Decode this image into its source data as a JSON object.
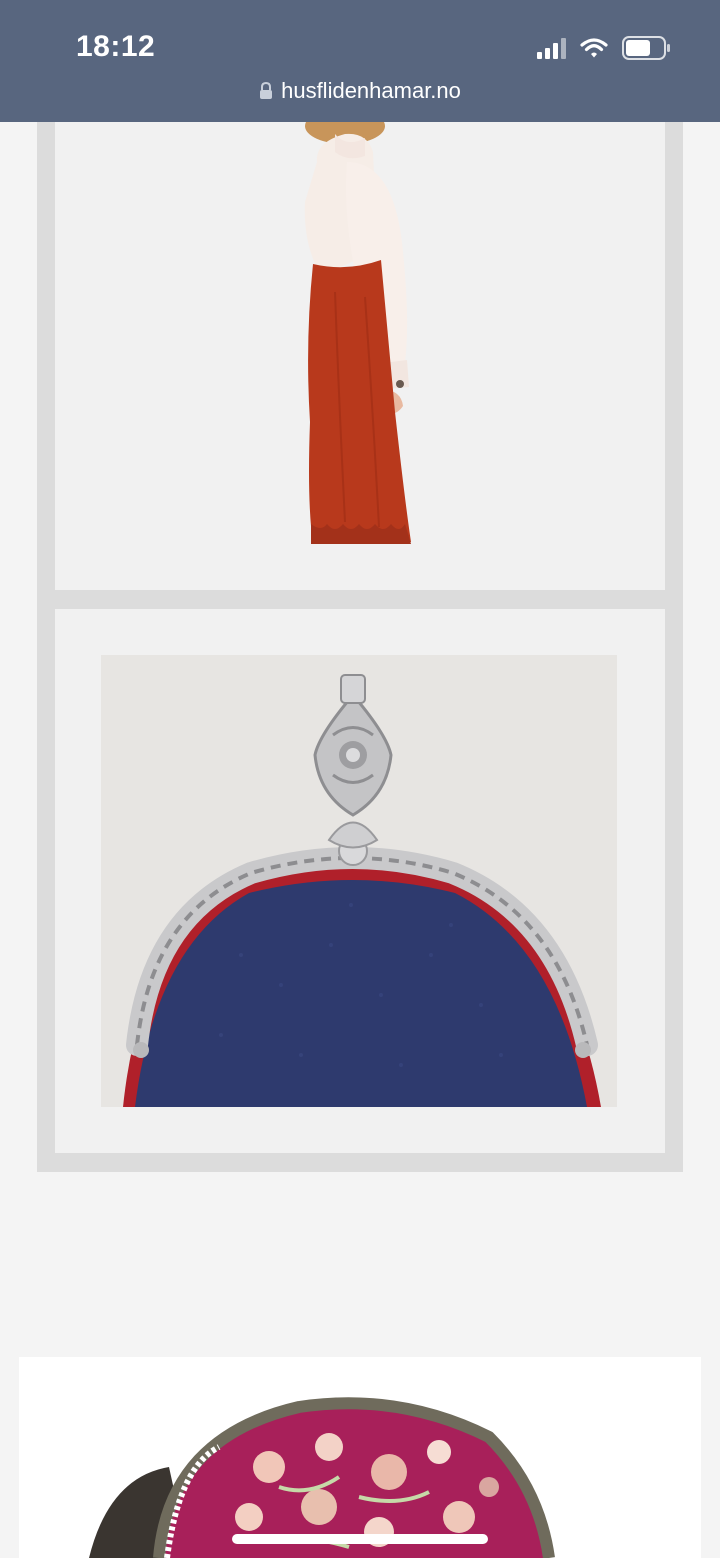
{
  "status_bar": {
    "time": "18:12",
    "icons": [
      "cellular-signal-icon",
      "wifi-icon",
      "battery-icon"
    ]
  },
  "browser": {
    "url": "husflidenhamar.no",
    "lock_icon": "lock-icon"
  },
  "gallery": {
    "items": [
      {
        "subject": "woman-blouse-red-skirt"
      },
      {
        "subject": "silver-frame-blue-bag"
      }
    ]
  },
  "next_product": {
    "subject": "embroidered-bonnet"
  },
  "colors": {
    "topbar": "#58667f",
    "skirt": "#b8391c",
    "bag_fabric": "#2e3a6e",
    "bag_piping": "#b0202a",
    "page_background": "#f4f4f4"
  }
}
